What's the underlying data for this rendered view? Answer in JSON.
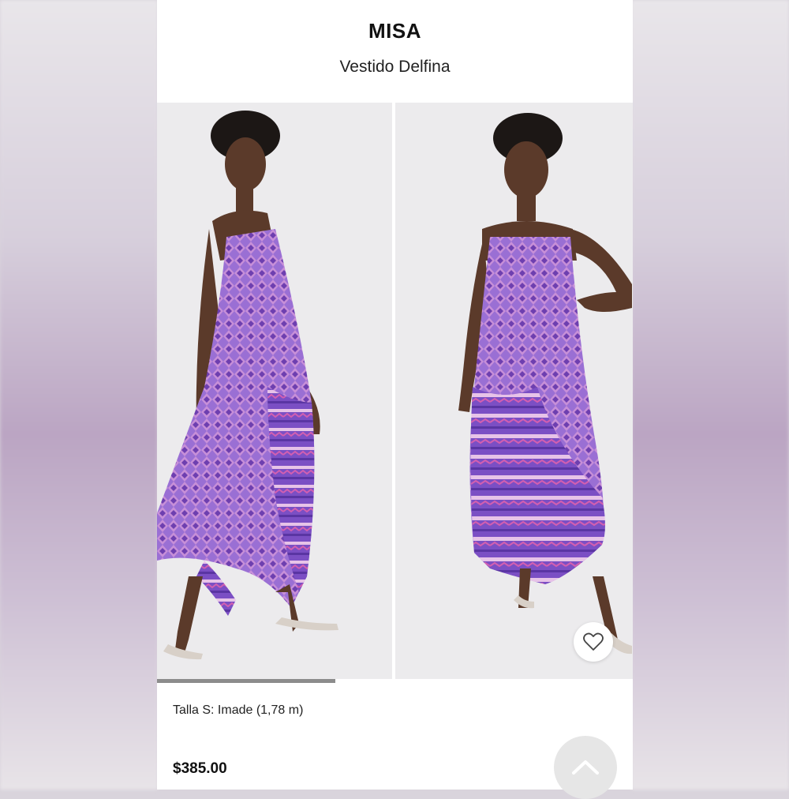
{
  "header": {
    "brand": "MISA",
    "product_name": "Vestido Delfina"
  },
  "gallery": {
    "images": [
      {
        "icon": "model-side-view-image"
      },
      {
        "icon": "model-front-view-image"
      }
    ],
    "carousel_progress": 0.375
  },
  "actions": {
    "favorite_icon": "heart-icon",
    "scroll_top_icon": "chevron-up-icon"
  },
  "details": {
    "size_info": "Talla S: Imade (1,78 m)",
    "price": "$385.00"
  },
  "colors": {
    "dress_primary": "#8a5cc8",
    "dress_secondary": "#c25aa8"
  }
}
